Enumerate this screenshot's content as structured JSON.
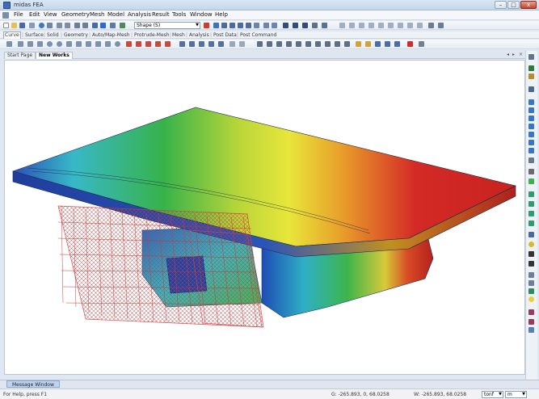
{
  "window": {
    "title": "midas FEA",
    "min_label": "–",
    "max_label": "□",
    "close_label": "x"
  },
  "menu": [
    {
      "id": "file",
      "label": "File"
    },
    {
      "id": "edit",
      "label": "Edit"
    },
    {
      "id": "view",
      "label": "View"
    },
    {
      "id": "geometry",
      "label": "Geometry"
    },
    {
      "id": "mesh",
      "label": "Mesh"
    },
    {
      "id": "model",
      "label": "Model"
    },
    {
      "id": "analysis",
      "label": "Analysis"
    },
    {
      "id": "result",
      "label": "Result"
    },
    {
      "id": "tools",
      "label": "Tools"
    },
    {
      "id": "window",
      "label": "Window"
    },
    {
      "id": "help",
      "label": "Help"
    }
  ],
  "toolbar": {
    "shape_select": "Shape (S)"
  },
  "ribbon_tabs": [
    {
      "id": "curve",
      "label": "Curve"
    },
    {
      "id": "surface",
      "label": "Surface"
    },
    {
      "id": "solid",
      "label": "Solid"
    },
    {
      "id": "geometry",
      "label": "Geometry"
    },
    {
      "id": "automap",
      "label": "Auto/Map-Mesh"
    },
    {
      "id": "protrude",
      "label": "Protrude-Mesh"
    },
    {
      "id": "mesh",
      "label": "Mesh"
    },
    {
      "id": "analysis",
      "label": "Analysis"
    },
    {
      "id": "postdata",
      "label": "Post Data"
    },
    {
      "id": "postcommand",
      "label": "Post Command"
    }
  ],
  "doc_tabs": {
    "start": "Start Page",
    "new": "New Works"
  },
  "message_window": "Message Window",
  "status": {
    "help": "For Help, press F1",
    "g_coord": "G: -265.893, 0, 68.0258",
    "w_coord": "W: -265.893, 68.0258",
    "force_unit": "tonf",
    "length_unit": "m"
  },
  "colors": {
    "contour_red": "#d42a26",
    "contour_yellow": "#e8e63a",
    "contour_green": "#37b24a",
    "contour_cyan": "#38b8c8",
    "contour_blue": "#2c4fb8",
    "rebar": "#d23a3a"
  }
}
